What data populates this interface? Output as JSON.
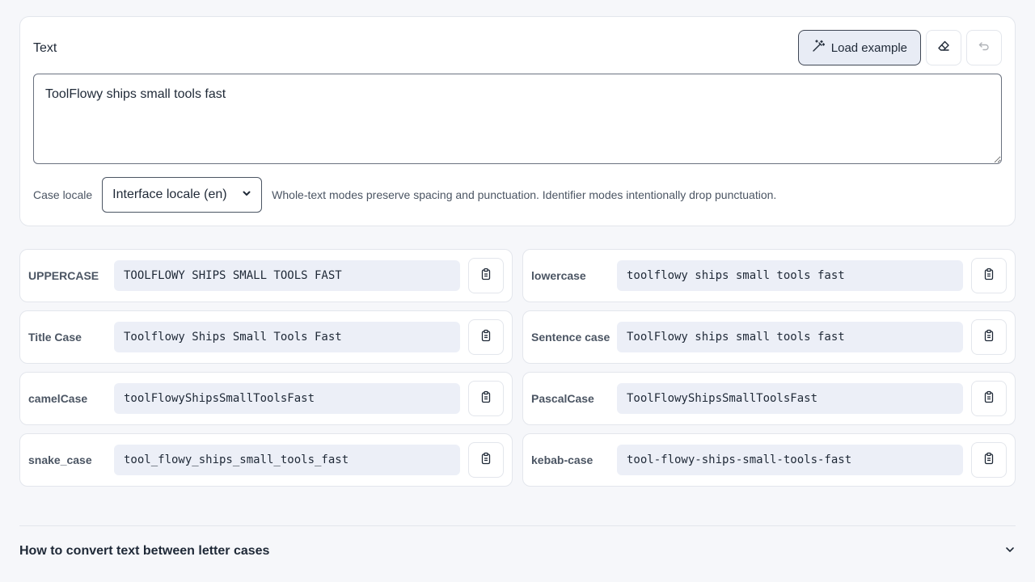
{
  "input": {
    "label": "Text",
    "load_example_label": "Load example",
    "value": "ToolFlowy ships small tools fast",
    "locale_label": "Case locale",
    "locale_selected": "Interface locale (en)",
    "hint": "Whole-text modes preserve spacing and punctuation. Identifier modes intentionally drop punctuation."
  },
  "results": [
    {
      "label": "UPPERCASE",
      "value": "TOOLFLOWY SHIPS SMALL TOOLS FAST"
    },
    {
      "label": "lowercase",
      "value": "toolflowy ships small tools fast"
    },
    {
      "label": "Title Case",
      "value": "Toolflowy Ships Small Tools Fast"
    },
    {
      "label": "Sentence case",
      "value": "ToolFlowy ships small tools fast"
    },
    {
      "label": "camelCase",
      "value": "toolFlowyShipsSmallToolsFast"
    },
    {
      "label": "PascalCase",
      "value": "ToolFlowyShipsSmallToolsFast"
    },
    {
      "label": "snake_case",
      "value": "tool_flowy_ships_small_tools_fast"
    },
    {
      "label": "kebab-case",
      "value": "tool-flowy-ships-small-tools-fast"
    }
  ],
  "faq": {
    "title": "How to convert text between letter cases"
  },
  "icons": {
    "load_example": "magic-wand-icon",
    "clear": "eraser-icon",
    "undo": "undo-icon",
    "copy": "clipboard-icon",
    "expand": "chevron-down-icon"
  },
  "colors": {
    "page_bg": "#f6f7fa",
    "value_bg": "#eceff7",
    "primary_btn_bg": "#e8ecf5"
  }
}
